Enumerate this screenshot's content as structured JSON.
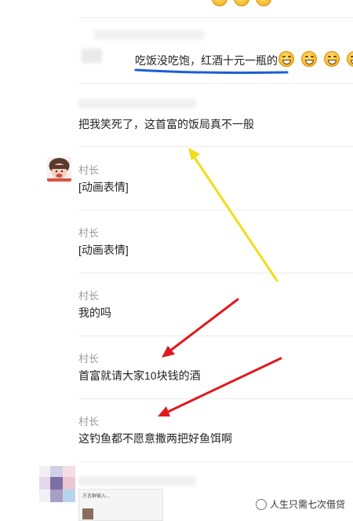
{
  "messages": [
    {
      "name": "",
      "text": "吃饭没吃饱，红酒十元一瓶的"
    },
    {
      "name": "",
      "text": "把我笑死了，这首富的饭局真不一般"
    },
    {
      "name": "村长",
      "text": "[动画表情]"
    },
    {
      "name": "村长",
      "text": "[动画表情]"
    },
    {
      "name": "村长",
      "text": "我的吗"
    },
    {
      "name": "村长",
      "text": "首富就请大家10块钱的酒"
    },
    {
      "name": "村长",
      "text": "这钓鱼都不愿意撒两把好鱼饵啊"
    }
  ],
  "emojis": [
    "grin-emoji",
    "grin-emoji",
    "grin-emoji",
    "grin-emoji"
  ],
  "colors": {
    "underline": "#1a5fd6",
    "yellow_arrow": "#f2dc19",
    "red_arrow": "#e0191e"
  },
  "thumbnail": {
    "header": "方言群输入..."
  },
  "watermark": {
    "text": "人生只需七次借贷"
  }
}
